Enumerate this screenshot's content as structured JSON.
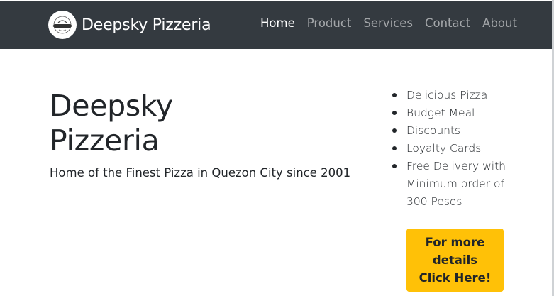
{
  "navbar": {
    "brand": "Deepsky Pizzeria",
    "links": [
      {
        "label": "Home",
        "active": true
      },
      {
        "label": "Product",
        "active": false
      },
      {
        "label": "Services",
        "active": false
      },
      {
        "label": "Contact",
        "active": false
      },
      {
        "label": "About",
        "active": false
      }
    ],
    "background_color": "#343a40"
  },
  "hero": {
    "title_line1": "Deepsky",
    "title_line2": "Pizzeria",
    "subtitle": "Home of the Finest Pizza in Quezon City since 2001"
  },
  "features": [
    "Delicious Pizza",
    "Budget Meal",
    "Discounts",
    "Loyalty Cards",
    "Free Delivery with Minimum order of 300 Pesos"
  ],
  "cta": {
    "line1": "For more",
    "line2": "details",
    "line3": "Click Here!",
    "color": "#ffc107"
  }
}
